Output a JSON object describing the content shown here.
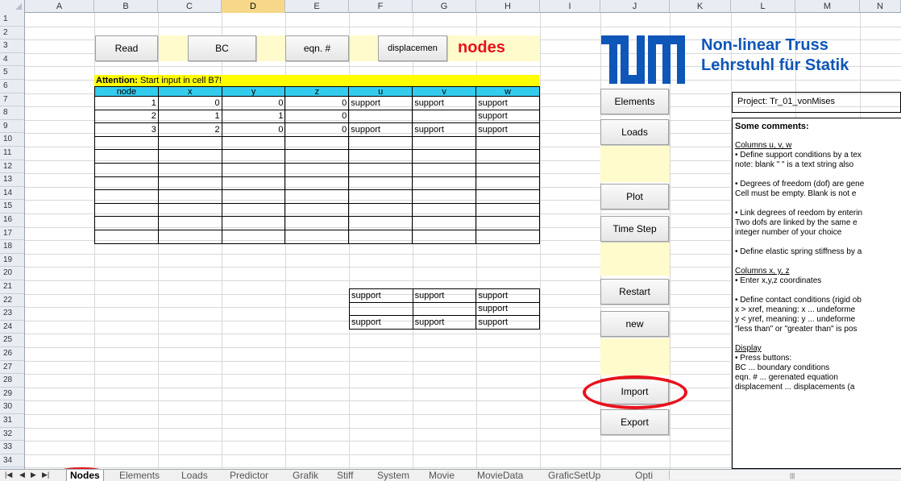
{
  "columns": [
    "A",
    "B",
    "C",
    "D",
    "E",
    "F",
    "G",
    "H",
    "I",
    "J",
    "K",
    "L",
    "M",
    "N"
  ],
  "rows": [
    "1",
    "2",
    "3",
    "4",
    "5",
    "6",
    "7",
    "8",
    "9",
    "10",
    "11",
    "12",
    "13",
    "14",
    "15",
    "16",
    "17",
    "18",
    "19",
    "20",
    "21",
    "22",
    "23",
    "24",
    "25",
    "26",
    "27",
    "28",
    "29",
    "30",
    "31",
    "32",
    "33",
    "34"
  ],
  "top_buttons": {
    "read": "Read",
    "bc": "BC",
    "eqn": "eqn. #",
    "displacement": "displacemen"
  },
  "sheet_title": "nodes",
  "attention": {
    "label": "Attention:",
    "text": " Start input in cell B7!"
  },
  "nodes_table": {
    "headers": [
      "node",
      "x",
      "y",
      "z",
      "u",
      "v",
      "w"
    ],
    "rows": [
      [
        "1",
        "0",
        "0",
        "0",
        "support",
        "support",
        "support"
      ],
      [
        "2",
        "1",
        "1",
        "0",
        "",
        "",
        "support"
      ],
      [
        "3",
        "2",
        "0",
        "0",
        "support",
        "support",
        "support"
      ]
    ],
    "empty_rows": 8
  },
  "support_table": {
    "rows": [
      [
        "support",
        "support",
        "support"
      ],
      [
        "",
        "",
        "support"
      ],
      [
        "support",
        "support",
        "support"
      ]
    ]
  },
  "side_buttons": {
    "elements": "Elements",
    "loads": "Loads",
    "plot": "Plot",
    "time_step": "Time Step",
    "restart": "Restart",
    "new": "new",
    "import": "Import",
    "export": "Export"
  },
  "header": {
    "title_line1": "Non-linear Truss",
    "title_line2": "Lehrstuhl für Statik"
  },
  "project": "Project: Tr_01_vonMises",
  "comments": {
    "heading": "Some comments:",
    "cols_uvw": "Columns u, v, w",
    "l1": "• Define support conditions by a tex",
    "l2": "  note: blank \" \" is a text  string also",
    "l3": "• Degrees of freedom (dof) are gene",
    "l4": "  Cell must be empty. Blank is not e",
    "l5": "• Link degrees of reedom by enterin",
    "l6": "  Two dofs are linked by the same e",
    "l7": "  integer number of your choice",
    "l8": "• Define elastic spring stiffness by a",
    "cols_xyz": "Columns x, y, z",
    "l9": "• Enter x,y,z  coordinates",
    "l10": "• Define contact conditions (rigid ob",
    "l11": "  x > xref,  meaning:  x ... undeforme",
    "l12": "  y < yref,  meaning:  y ... undeforme",
    "l13": "  \"less than\" or \"greater than\" is pos",
    "display": "Display",
    "l14": "• Press buttons:",
    "l15": "  BC          ... boundary conditions",
    "l16": "  eqn. #      ... gerenated equation",
    "l17": "  displacement ... displacements (a"
  },
  "sheet_tabs": [
    "Nodes",
    "Elements",
    "Loads",
    "Predictor",
    "Grafik",
    "Stiff",
    "System",
    "Movie",
    "MovieData",
    "GraficSetUp",
    "Opti"
  ],
  "accent": {
    "red": "#e8121c",
    "blue": "#0e56b8",
    "cyan": "#33ccee",
    "yellow": "#ffff00"
  }
}
